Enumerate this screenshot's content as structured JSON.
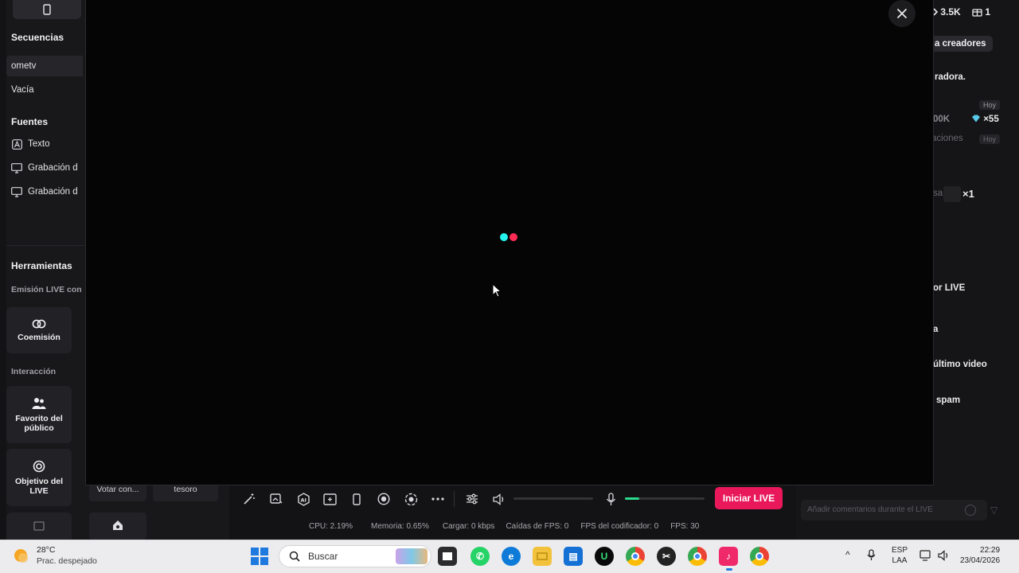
{
  "sidebar": {
    "sequences_title": "Secuencias",
    "sequences": [
      "ometv",
      "Vacía"
    ],
    "sources_title": "Fuentes",
    "sources": [
      "Texto",
      "Grabación d",
      "Grabación d"
    ],
    "tools_title": "Herramientas",
    "emission_title": "Emisión LIVE con",
    "coemission_label": "Coemisión",
    "interaction_title": "Interacción",
    "favorite_label": "Favorito del público",
    "objective_label": "Objetivo del LIVE"
  },
  "col2": {
    "vote_label": "Votar con...",
    "treasure_label": "tesoro"
  },
  "right_panel": {
    "stat_views": "3.5K",
    "stat_gifts": "1",
    "creators_chip": "a creadores",
    "text_1": "radora.",
    "badge_today_1": "Hoy",
    "text_2": "00K",
    "gift_count": "×55",
    "text_3": "aciones",
    "badge_today_2": "Hoy",
    "text_4": "sa",
    "multiplier": "×1",
    "text_5": "or LIVE",
    "text_6": "a",
    "text_7": "último video",
    "text_8": "spam",
    "text_9": "Añadir comentarios durante el LIVE"
  },
  "toolbar": {
    "live_button": "Iniciar LIVE",
    "mic_level": 0.18
  },
  "status_bar": {
    "cpu": "CPU: 2.19%",
    "memory": "Memoria: 0.65%",
    "load": "Cargar: 0 kbps",
    "fps_drops": "Caídas de FPS: 0",
    "encoder_fps": "FPS del codificador: 0",
    "fps": "FPS: 30"
  },
  "taskbar": {
    "temperature": "28°C",
    "weather_desc": "Prac. despejado",
    "search_placeholder": "Buscar",
    "lang_top": "ESP",
    "lang_bottom": "LAA",
    "time": "22:29",
    "date": "23/04/2026"
  },
  "colors": {
    "live_accent": "#e8185a",
    "loader_cyan": "#25f4ee",
    "loader_pink": "#fe2c55",
    "mic_green": "#2bd98a"
  }
}
